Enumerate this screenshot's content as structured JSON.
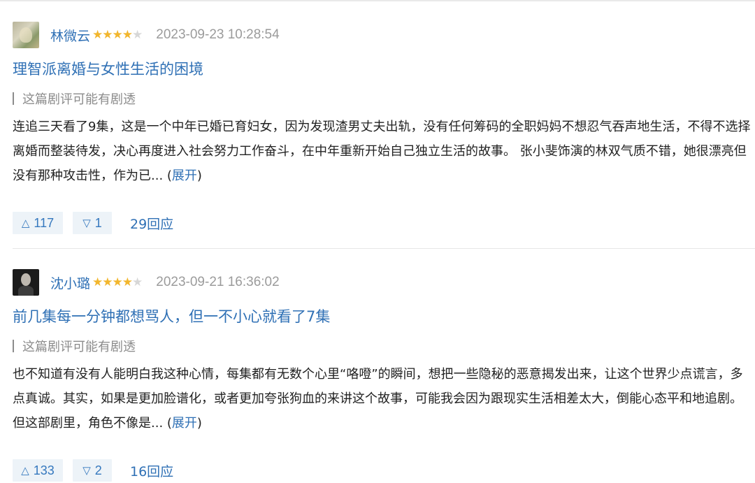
{
  "reviews": [
    {
      "username": "林微云",
      "rating": 4,
      "timestamp": "2023-09-23 10:28:54",
      "title": "理智派离婚与女性生活的困境",
      "spoiler": "这篇剧评可能有剧透",
      "body": "连追三天看了9集，这是一个中年已婚已育妇女，因为发现渣男丈夫出轨，没有任何筹码的全职妈妈不想忍气吞声地生活，不得不选择离婚而整装待发，决心再度进入社会努力工作奋斗，在中年重新开始自己独立生活的故事。 张小斐饰演的林双气质不错，她很漂亮但没有那种攻击性，作为已... (",
      "expand": "展开",
      "upvotes": "117",
      "downvotes": "1",
      "replies": "29回应"
    },
    {
      "username": "沈小璐",
      "rating": 4,
      "timestamp": "2023-09-21 16:36:02",
      "title": "前几集每一分钟都想骂人，但一不小心就看了7集",
      "spoiler": "这篇剧评可能有剧透",
      "body": "也不知道有没有人能明白我这种心情，每集都有无数个心里“咯噔”的瞬间，想把一些隐秘的恶意揭发出来，让这个世界少点谎言，多点真诚。其实，如果是更加脸谱化，或者更加夸张狗血的来讲这个故事，可能我会因为跟现实生活相差太大，倒能心态平和地追剧。 但这部剧里，角色不像是... (",
      "expand": "展开",
      "upvotes": "133",
      "downvotes": "2",
      "replies": "16回应"
    }
  ],
  "symbols": {
    "star_on": "★",
    "star_off": "★",
    "up_icon": "△",
    "down_icon": "▽",
    "close_paren": ")"
  },
  "colors": {
    "link": "#2f70b5",
    "star": "#f2b62d",
    "vote_bg": "#edf3f8"
  }
}
